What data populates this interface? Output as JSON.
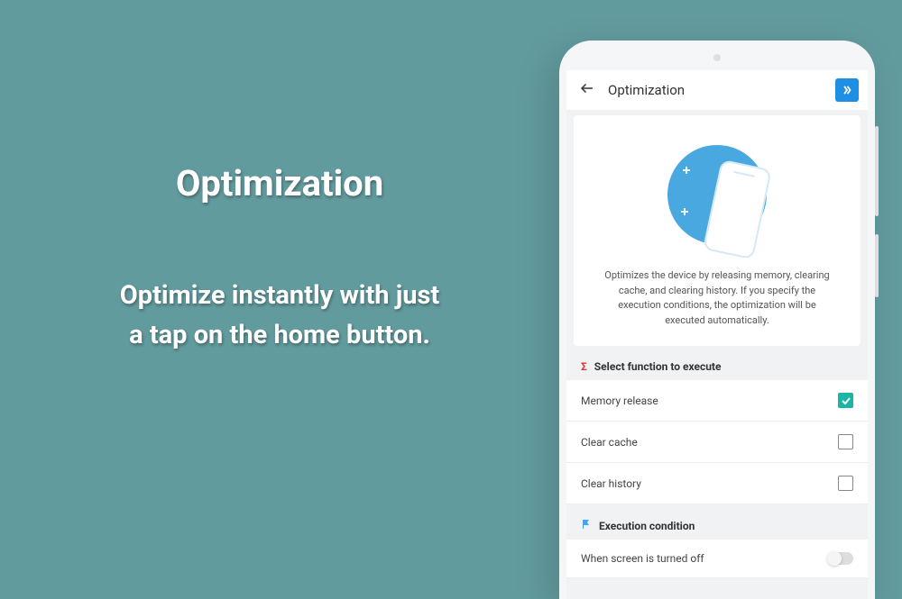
{
  "promo": {
    "title": "Optimization",
    "subtitle_line1": "Optimize instantly with just",
    "subtitle_line2": "a tap on the home button."
  },
  "header": {
    "title": "Optimization"
  },
  "hero": {
    "description": "Optimizes the device by releasing memory, clearing cache, and clearing history. If you specify the execution conditions, the optimization will be executed automatically."
  },
  "functions_section": {
    "title": "Select function to execute",
    "items": [
      {
        "label": "Memory release",
        "checked": true
      },
      {
        "label": "Clear cache",
        "checked": false
      },
      {
        "label": "Clear history",
        "checked": false
      }
    ]
  },
  "conditions_section": {
    "title": "Execution condition",
    "items": [
      {
        "label": "When screen is turned off",
        "on": false
      }
    ]
  },
  "colors": {
    "background": "#629b9e",
    "accent_blue": "#1f8fe5",
    "accent_teal": "#19b5a5"
  }
}
